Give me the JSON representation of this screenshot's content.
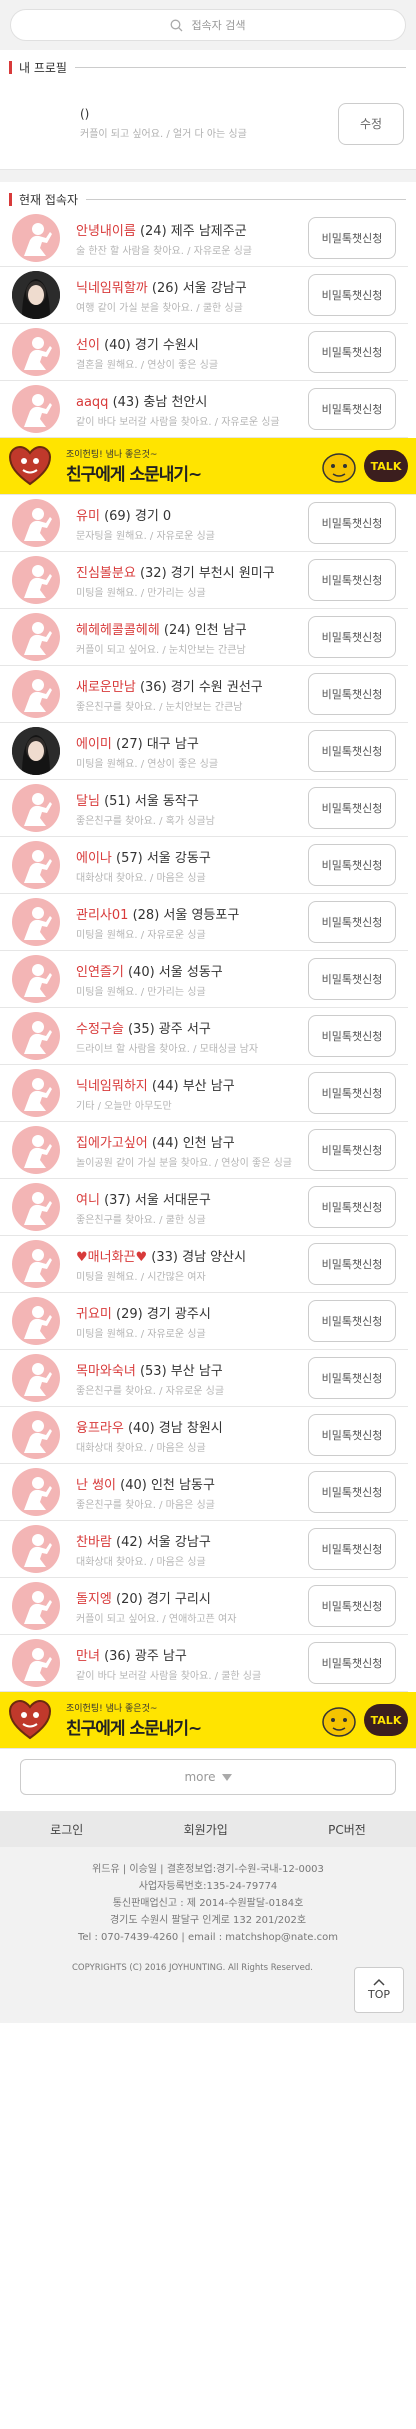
{
  "search": {
    "placeholder": "접속자 검색"
  },
  "my_profile": {
    "section_title": "내 프로필",
    "name": "()",
    "intro": "커플이 되고 싶어요. / 얼거 다 아는 싱글",
    "edit_label": "수정"
  },
  "online": {
    "section_title": "현재 접속자"
  },
  "chat_label": "비밀톡챗신청",
  "users_a": [
    {
      "nick": "안녕내이름",
      "meta": "(24) 제주 남제주군",
      "sub": "술 한잔 할 사람을 찾아요. / 자유로운 싱글",
      "photo": false
    },
    {
      "nick": "닉네임뭐할까",
      "meta": "(26) 서울 강남구",
      "sub": "여행 같이 가실 분을 찾아요. / 쿨한 싱글",
      "photo": true
    },
    {
      "nick": "선이",
      "meta": "(40) 경기 수원시",
      "sub": "결혼을 원해요. / 연상이 좋은 싱글",
      "photo": false
    },
    {
      "nick": "aaqq",
      "meta": "(43) 충남 천안시",
      "sub": "같이 바다 보러갈 사람을 찾아요. / 자유로운 싱글",
      "photo": false
    }
  ],
  "banner": {
    "small": "조이헌팅! 냄나 좋은것~",
    "big": "친구에게 소문내기~",
    "talk": "TALK"
  },
  "users_b": [
    {
      "nick": "유미",
      "meta": "(69) 경기 0",
      "sub": "문자팅을 원해요. / 자유로운 싱글",
      "photo": false
    },
    {
      "nick": "진심볼분요",
      "meta": "(32) 경기 부천시 원미구",
      "sub": "미팅을 원해요. / 만가리는 싱글",
      "photo": false
    },
    {
      "nick": "헤헤헤콜콜헤헤",
      "meta": "(24) 인천 남구",
      "sub": "커플이 되고 싶어요. / 눈치안보는 간큰남",
      "photo": false
    },
    {
      "nick": "새로운만남",
      "meta": "(36) 경기 수원 권선구",
      "sub": "좋은친구를 찾아요. / 눈치안보는 간큰남",
      "photo": false
    },
    {
      "nick": "에이미",
      "meta": "(27) 대구 남구",
      "sub": "미팅을 원해요. / 연상이 좋은 싱글",
      "photo": true
    },
    {
      "nick": "달님",
      "meta": "(51) 서울 동작구",
      "sub": "좋은친구를 찾아요. / 혹가 싱글남",
      "photo": false
    },
    {
      "nick": "에이나",
      "meta": "(57) 서울 강동구",
      "sub": "대화상대 찾아요. / 마음은 싱글",
      "photo": false
    },
    {
      "nick": "관리사01",
      "meta": "(28) 서울 영등포구",
      "sub": "미팅을 원해요. / 자유로운 싱글",
      "photo": false
    },
    {
      "nick": "인연즐기",
      "meta": "(40) 서울 성동구",
      "sub": "미팅을 원해요. / 만가리는 싱글",
      "photo": false
    },
    {
      "nick": "수정구슬",
      "meta": "(35) 광주 서구",
      "sub": "드라이브 할 사람을 찾아요. / 모태싱글 남자",
      "photo": false
    },
    {
      "nick": "닉네임뭐하지",
      "meta": "(44) 부산 남구",
      "sub": "기타 / 오늘만 아무도만",
      "photo": false
    },
    {
      "nick": "집에가고싶어",
      "meta": "(44) 인천 남구",
      "sub": "놀이공원 같이 가실 분을 찾아요. / 연상이 좋은 싱글",
      "photo": false
    },
    {
      "nick": "여니",
      "meta": "(37) 서울 서대문구",
      "sub": "좋은친구를 찾아요. / 쿨한 싱글",
      "photo": false
    },
    {
      "nick": "♥매너화끈♥",
      "meta": "(33) 경남 양산시",
      "sub": "미팅을 원해요. / 시간많은 여자",
      "photo": false
    },
    {
      "nick": "귀요미",
      "meta": "(29) 경기 광주시",
      "sub": "미팅을 원해요. / 자유로운 싱글",
      "photo": false
    },
    {
      "nick": "목마와숙녀",
      "meta": "(53) 부산 남구",
      "sub": "좋은친구를 찾아요. / 자유로운 싱글",
      "photo": false
    },
    {
      "nick": "융프라우",
      "meta": "(40) 경남 창원시",
      "sub": "대화상대 찾아요. / 마음은 싱글",
      "photo": false
    },
    {
      "nick": "난 썽이",
      "meta": "(40) 인천 남동구",
      "sub": "좋은친구를 찾아요. / 마음은 싱글",
      "photo": false
    },
    {
      "nick": "찬바람",
      "meta": "(42) 서울 강남구",
      "sub": "대화상대 찾아요. / 마음은 싱글",
      "photo": false
    },
    {
      "nick": "돌지엥",
      "meta": "(20) 경기 구리시",
      "sub": "커플이 되고 싶어요. / 연애하고픈 여자",
      "photo": false
    },
    {
      "nick": "만녀",
      "meta": "(36) 광주 남구",
      "sub": "같이 바다 보러갈 사람을 찾아요. / 쿨한 싱글",
      "photo": false
    }
  ],
  "more_label": "more",
  "footer_nav": {
    "login": "로그인",
    "join": "회원가입",
    "pc": "PC버전"
  },
  "footer_info": [
    "위드유 | 이승일 | 결혼정보업:경기-수원-국내-12-0003",
    "사업자등록번호:135-24-79774",
    "통신판매업신고 : 제 2014-수원팔달-0184호",
    "경기도 수원시 팔달구 인계로 132 201/202호",
    "Tel : 070-7439-4260 | email : matchshop@nate.com"
  ],
  "copyright": "COPYRIGHTS (C) 2016 JOYHUNTING. All Rights Reserved.",
  "top_label": "TOP",
  "colors": {
    "accent": "#d83a3a",
    "avatar": "#f3b5b5",
    "banner": "#ffe400"
  }
}
